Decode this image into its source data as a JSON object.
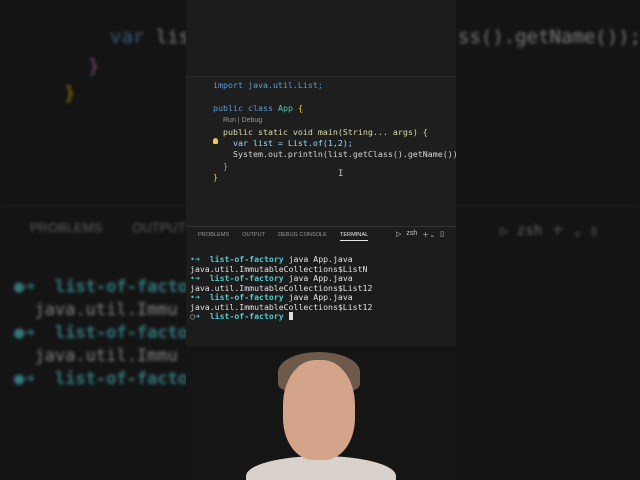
{
  "editor": {
    "import_line": "import java.util.List;",
    "class_decl": [
      "public",
      "class",
      "App",
      "{"
    ],
    "codelens": "Run | Debug",
    "main_decl": "public static void main(String... args) {",
    "line_var": "var list = List.of(1,2);",
    "line_print": "System.out.println(list.getClass().getName());"
  },
  "panel_tabs": [
    "PROBLEMS",
    "OUTPUT",
    "DEBUG CONSOLE",
    "TERMINAL"
  ],
  "active_tab": "TERMINAL",
  "terminal_shell": "zsh",
  "terminal": {
    "prompt_dir": "list-of-factory",
    "command": "java App.java",
    "outputs": [
      "java.util.ImmutableCollections$ListN",
      "java.util.ImmutableCollections$List12",
      "java.util.ImmutableCollections$List12"
    ]
  }
}
